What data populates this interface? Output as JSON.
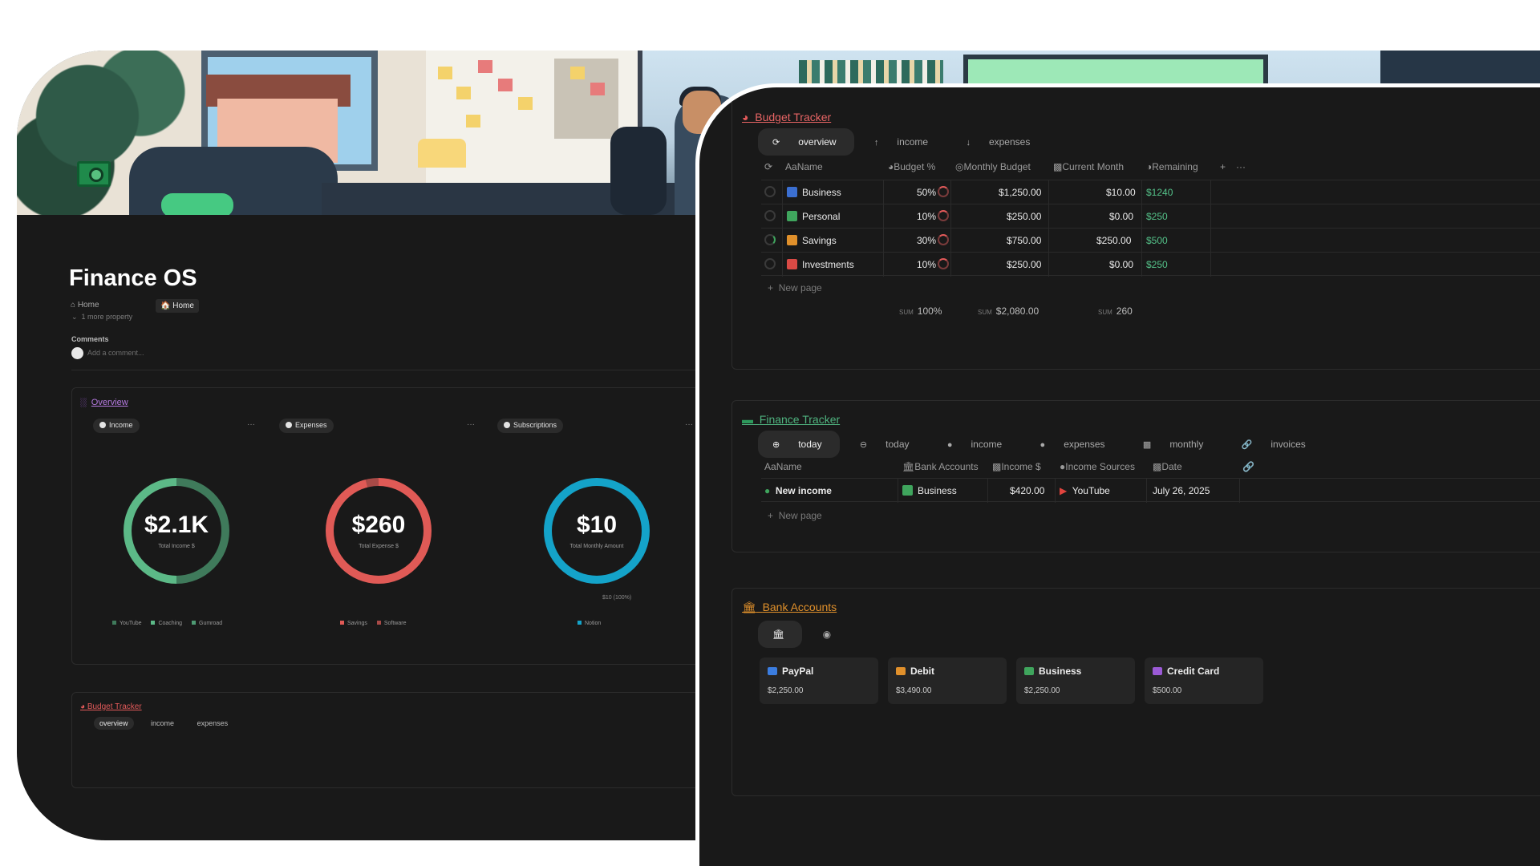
{
  "page": {
    "title": "Finance OS",
    "property_label": "Home",
    "property_value": "Home",
    "more_property": "1 more property",
    "comments_label": "Comments",
    "comment_placeholder": "Add a comment..."
  },
  "overview": {
    "title": "Overview",
    "views": [
      {
        "label": "Income",
        "amount": "$2.1K",
        "caption": "Total Income $",
        "legend": [
          "YouTube",
          "Coaching",
          "Gumroad"
        ],
        "color": "#3f7a5b",
        "color_light": "#5cb987"
      },
      {
        "label": "Expenses",
        "amount": "$260",
        "caption": "Total Expense $",
        "legend": [
          "Savings",
          "Software"
        ],
        "color": "#e05a56",
        "color_light": "#a84a47"
      },
      {
        "label": "Subscriptions",
        "amount": "$10",
        "caption": "Total Monthly Amount",
        "legend": [
          "Notion"
        ],
        "color": "#14a3c9",
        "note": "$10 (100%)"
      }
    ],
    "more": "···"
  },
  "budget_tracker": {
    "title": "Budget Tracker",
    "tabs": [
      "overview",
      "income",
      "expenses"
    ],
    "columns": [
      "Name",
      "Budget %",
      "Monthly Budget",
      "Current Month",
      "Remaining"
    ],
    "rows": [
      {
        "name": "Business",
        "budget_pct": "50%",
        "monthly_budget": "$1,250.00",
        "current_month": "$10.00",
        "remaining": "$1240",
        "icon_color": "#3b6fd1"
      },
      {
        "name": "Personal",
        "budget_pct": "10%",
        "monthly_budget": "$250.00",
        "current_month": "$0.00",
        "remaining": "$250",
        "icon_color": "#3fa55d"
      },
      {
        "name": "Savings",
        "budget_pct": "30%",
        "monthly_budget": "$750.00",
        "current_month": "$250.00",
        "remaining": "$500",
        "icon_color": "#e0902b"
      },
      {
        "name": "Investments",
        "budget_pct": "10%",
        "monthly_budget": "$250.00",
        "current_month": "$0.00",
        "remaining": "$250",
        "icon_color": "#d94a45"
      }
    ],
    "new_page": "New page",
    "sum_label": "SUM",
    "sums": {
      "budget_pct": "100%",
      "monthly_budget": "$2,080.00",
      "remaining": "260"
    },
    "add": "+",
    "more": "···"
  },
  "finance_tracker": {
    "title": "Finance Tracker",
    "tabs": [
      "today",
      "today",
      "income",
      "expenses",
      "monthly",
      "invoices"
    ],
    "columns": [
      "Name",
      "Bank Accounts",
      "Income $",
      "Income Sources",
      "Date"
    ],
    "row": {
      "name": "New income",
      "bank": "Business",
      "income": "$420.00",
      "source": "YouTube",
      "date": "July 26, 2025"
    },
    "new_page": "New page"
  },
  "bank_accounts": {
    "title": "Bank Accounts",
    "cards": [
      {
        "name": "PayPal",
        "amount": "$2,250.00",
        "color": "#3b7de0"
      },
      {
        "name": "Debit",
        "amount": "$3,490.00",
        "color": "#e0902b"
      },
      {
        "name": "Business",
        "amount": "$2,250.00",
        "color": "#3fa55d"
      },
      {
        "name": "Credit Card",
        "amount": "$500.00",
        "color": "#9b5ad6"
      }
    ]
  },
  "mini_budget": {
    "title": "Budget Tracker",
    "tabs": [
      "overview",
      "income",
      "expenses"
    ]
  }
}
